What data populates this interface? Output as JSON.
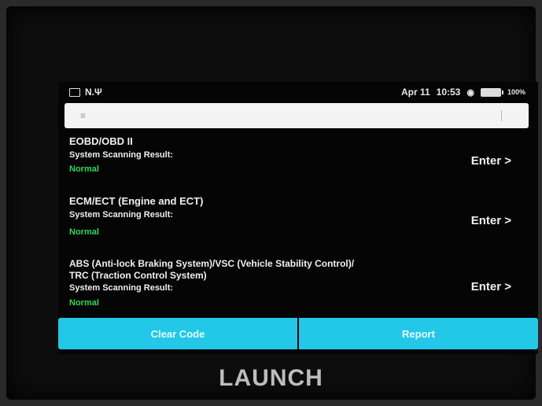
{
  "status_bar": {
    "left_text": "N.Ψ",
    "date": "Apr 11",
    "time": "10:53",
    "battery": "100%"
  },
  "list": {
    "items": [
      {
        "title": "EOBD/OBD II",
        "subtitle": "System Scanning Result:",
        "status": "Normal",
        "enter_label": "Enter >"
      },
      {
        "title": "ECM/ECT (Engine and ECT)",
        "subtitle": "System Scanning Result:",
        "status": "Normal",
        "enter_label": "Enter >"
      },
      {
        "title_line1": "ABS (Anti-lock Braking System)/VSC (Vehicle Stability Control)/",
        "title_line2": "TRC (Traction Control System)",
        "subtitle": "System Scanning Result:",
        "status": "Normal",
        "enter_label": "Enter >"
      }
    ]
  },
  "bottom": {
    "clear_code_label": "Clear Code",
    "report_label": "Report"
  },
  "brand": "LAUNCH",
  "colors": {
    "accent": "#23c8e8",
    "normal_status": "#2fd75a"
  }
}
